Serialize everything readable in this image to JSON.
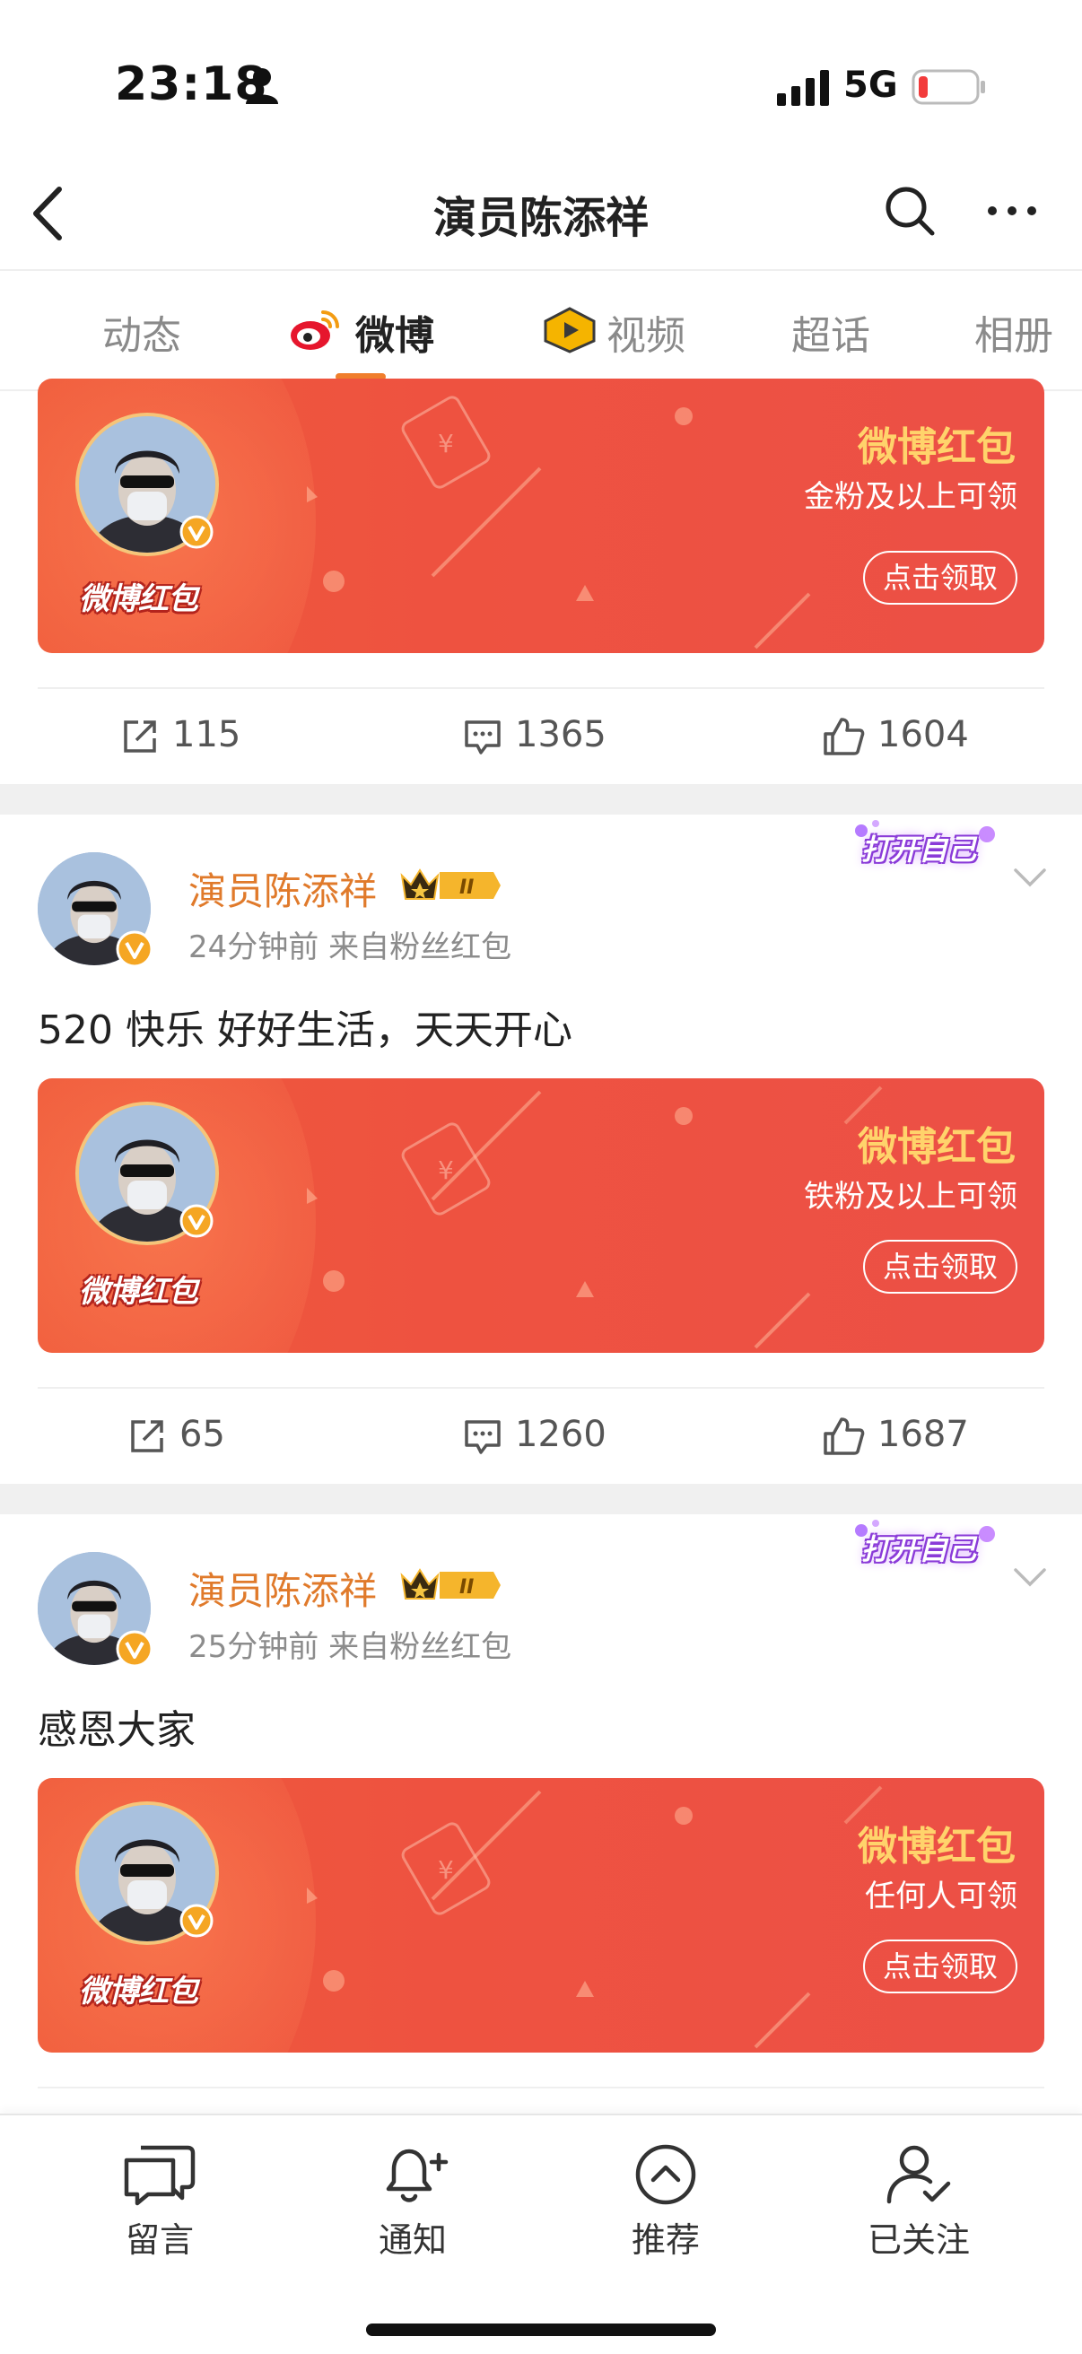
{
  "status": {
    "time": "23:18",
    "network": "5G"
  },
  "nav": {
    "title": "演员陈添祥"
  },
  "tabs": [
    {
      "label": "动态"
    },
    {
      "label": "微博"
    },
    {
      "label": "视频"
    },
    {
      "label": "超话"
    },
    {
      "label": "相册"
    }
  ],
  "banner_common": {
    "title": "微博红包",
    "button": "点击领取",
    "packet_label": "微博红包"
  },
  "banners": [
    {
      "subtitle": "金粉及以上可领"
    },
    {
      "subtitle": "铁粉及以上可领"
    },
    {
      "subtitle": "任何人可领"
    }
  ],
  "actions": [
    {
      "repost": "115",
      "comment": "1365",
      "like": "1604"
    },
    {
      "repost": "65",
      "comment": "1260",
      "like": "1687"
    }
  ],
  "posts": [
    {
      "author": "演员陈添祥",
      "meta": "24分钟前  来自粉丝红包",
      "text": "520 快乐 好好生活，天天开心",
      "sticker": "打开自己"
    },
    {
      "author": "演员陈添祥",
      "meta": "25分钟前  来自粉丝红包",
      "text": "感恩大家",
      "sticker": "打开自己"
    }
  ],
  "bottom_bar": [
    {
      "label": "留言",
      "icon": "message-icon"
    },
    {
      "label": "通知",
      "icon": "bell-icon"
    },
    {
      "label": "推荐",
      "icon": "chevron-up-circle-icon"
    },
    {
      "label": "已关注",
      "icon": "user-check-icon"
    }
  ],
  "colors": {
    "accent": "#f07e2c",
    "name": "#e07a2b",
    "banner": "#ee5240",
    "banner_title": "#ffd36b"
  }
}
